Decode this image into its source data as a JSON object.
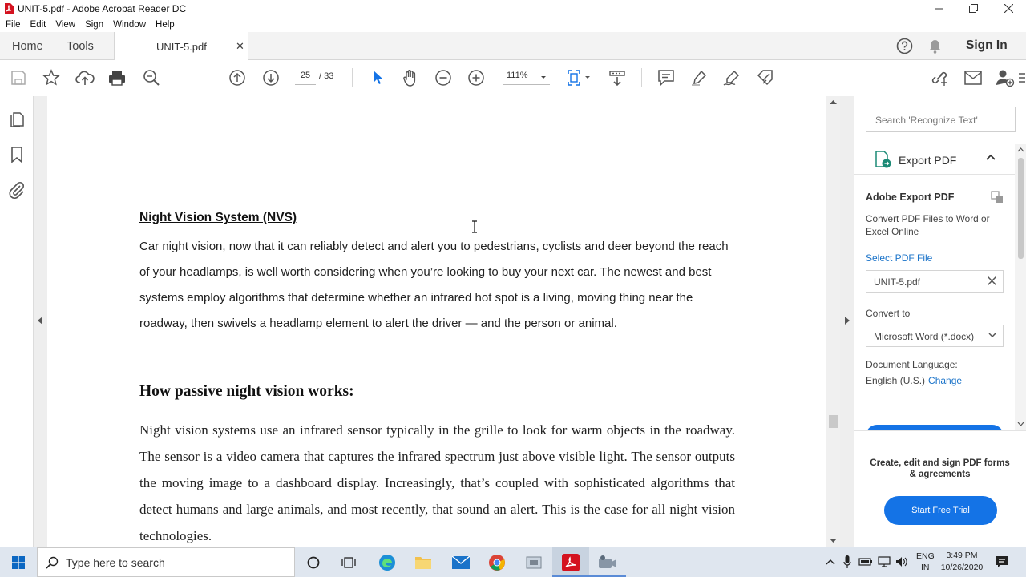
{
  "window": {
    "title": "UNIT-5.pdf - Adobe Acrobat Reader DC"
  },
  "menu": [
    "File",
    "Edit",
    "View",
    "Sign",
    "Window",
    "Help"
  ],
  "tabs": {
    "home": "Home",
    "tools": "Tools",
    "document": "UNIT-5.pdf",
    "close": "✕",
    "sign_in": "Sign In"
  },
  "toolbar": {
    "current_page": "25",
    "page_total": "/ 33",
    "zoom": "111%"
  },
  "document": {
    "heading1": "Night Vision System (NVS)",
    "para1": "Car night vision, now that it can reliably detect and alert you to pedestrians, cyclists and deer beyond the reach of your headlamps, is well worth considering when you’re looking to buy your next car. The newest and best systems employ algorithms that determine whether an infrared hot spot is a living, moving thing near the roadway, then swivels a headlamp element to alert the driver — and the person or animal.",
    "heading2": "How passive night vision works:",
    "para2": "Night vision systems use an infrared sensor typically in the grille to look for warm objects in the roadway. The sensor is a video camera that captures the infrared spectrum just above visible light. The sensor outputs the moving image to a dashboard display. Increasingly, that’s coupled with sophisticated algorithms that detect humans and large animals, and most recently, that sound an alert. This is the case for all night vision technologies."
  },
  "right_pane": {
    "search_placeholder": "Search 'Recognize Text'",
    "export_header": "Export PDF",
    "title": "Adobe Export PDF",
    "description": "Convert PDF Files to Word or Excel Online",
    "select_file": "Select PDF File",
    "file_name": "UNIT-5.pdf",
    "convert_to_label": "Convert to",
    "convert_to_value": "Microsoft Word (*.docx)",
    "doc_language_label": "Document Language:",
    "doc_language_value": "English (U.S.)",
    "change_link": "Change",
    "promo_text": "Create, edit and sign PDF forms & agreements",
    "trial_button": "Start Free Trial"
  },
  "taskbar": {
    "search_placeholder": "Type here to search",
    "lang_line1": "ENG",
    "lang_line2": "IN",
    "time": "3:49 PM",
    "date": "10/26/2020"
  },
  "colors": {
    "accent_blue": "#1473e6",
    "link_blue": "#1a73c9",
    "acrobat_red": "#d4121f"
  }
}
